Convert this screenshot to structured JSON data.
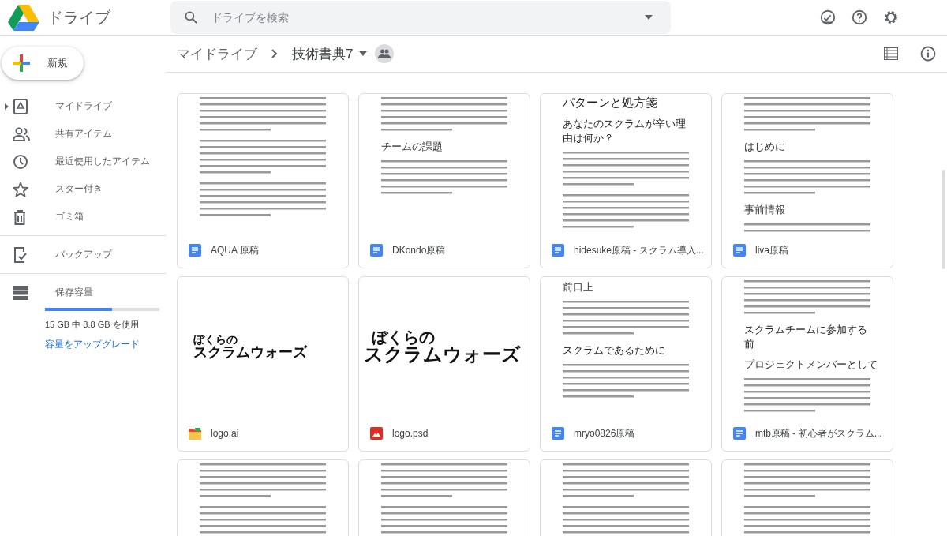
{
  "header": {
    "product": "ドライブ",
    "search": {
      "placeholder": "ドライブを検索"
    }
  },
  "new_button": {
    "label": "新規"
  },
  "sidebar": {
    "sections": [
      [
        {
          "label": "マイドライブ",
          "collapsed": true
        },
        {
          "label": "共有アイテム",
          "collapsed": false
        },
        {
          "label": "最近使用したアイテム",
          "collapsed": false
        },
        {
          "label": "スター付き",
          "collapsed": false
        },
        {
          "label": "ゴミ箱",
          "collapsed": false
        }
      ],
      [
        {
          "label": "バックアップ",
          "collapsed": false
        }
      ]
    ],
    "storage": {
      "label": "保存容量",
      "level": 0.587,
      "usage": "15 GB 中 8.8 GB を使用",
      "upgrade": "容量をアップグレード"
    }
  },
  "breadcrumb": {
    "items": [
      "マイドライブ",
      "技術書典7"
    ],
    "shared": true
  },
  "files": [
    {
      "name": "AQUA 原稿",
      "kind": "doc",
      "preview": [
        {
          "kind": "body"
        },
        {
          "kind": "body"
        },
        {
          "kind": "body"
        }
      ]
    },
    {
      "name": "DKondo原稿",
      "kind": "doc",
      "preview": [
        {
          "kind": "body"
        },
        {
          "kind": "heading",
          "text": "チームの課題"
        },
        {
          "kind": "body"
        }
      ]
    },
    {
      "name": "hidesuke原稿 - スクラム導入...",
      "kind": "doc",
      "preview": [
        {
          "kind": "title",
          "text": "パターンと処方箋"
        },
        {
          "kind": "heading2",
          "text": "あなたのスクラムが辛い理由は何か？"
        },
        {
          "kind": "body"
        },
        {
          "kind": "body"
        }
      ]
    },
    {
      "name": "liva原稿",
      "kind": "doc",
      "preview": [
        {
          "kind": "body"
        },
        {
          "kind": "heading",
          "text": "はじめに"
        },
        {
          "kind": "body"
        },
        {
          "kind": "heading",
          "text": "事前情報"
        },
        {
          "kind": "body"
        }
      ]
    },
    {
      "name": "logo.ai",
      "kind": "ai",
      "preview": [
        {
          "kind": "logo_small",
          "text": "ぼくらの",
          "subtext": "スクラムウォーズ"
        }
      ]
    },
    {
      "name": "logo.psd",
      "kind": "psd",
      "preview": [
        {
          "kind": "logo_large",
          "text": "ぼくらの",
          "subtext": "スクラムウォーズ"
        }
      ]
    },
    {
      "name": "mryo0826原稿",
      "kind": "doc",
      "preview": [
        {
          "kind": "heading",
          "text": "前口上"
        },
        {
          "kind": "body"
        },
        {
          "kind": "heading2",
          "text": "スクラムであるために"
        },
        {
          "kind": "body"
        }
      ]
    },
    {
      "name": "mtb原稿 - 初心者がスクラム...",
      "kind": "doc",
      "preview": [
        {
          "kind": "body"
        },
        {
          "kind": "heading2",
          "text": "スクラムチームに参加する前"
        },
        {
          "kind": "heading",
          "text": "プロジェクトメンバーとして"
        },
        {
          "kind": "body"
        }
      ]
    },
    {
      "preview": [
        {
          "kind": "body"
        },
        {
          "kind": "body"
        }
      ]
    },
    {
      "preview": [
        {
          "kind": "body"
        },
        {
          "kind": "body"
        }
      ]
    },
    {
      "preview": [
        {
          "kind": "body"
        },
        {
          "kind": "body"
        }
      ]
    },
    {
      "preview": [
        {
          "kind": "body"
        },
        {
          "kind": "body"
        }
      ]
    }
  ]
}
